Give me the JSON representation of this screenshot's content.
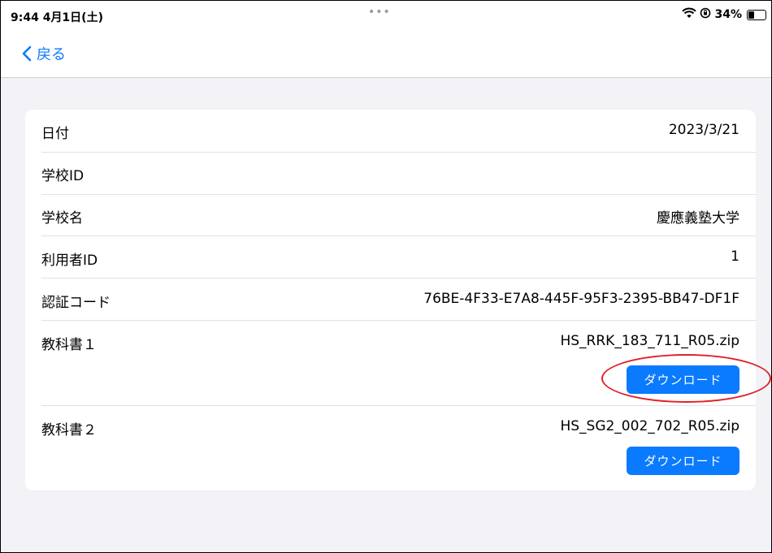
{
  "status_bar": {
    "time": "9:44  4月1日(土)",
    "dots": "•••",
    "battery_percent": "34%",
    "battery_level": 0.34,
    "icons": [
      "wifi-icon",
      "orientation-lock-icon",
      "battery-icon"
    ]
  },
  "nav": {
    "back_label": "戻る",
    "back_icon": "chevron-left-icon",
    "accent_color": "#0a7aff"
  },
  "details": {
    "date_label": "日付",
    "date_value": "2023/3/21",
    "school_id_label": "学校ID",
    "school_id_value": "",
    "school_name_label": "学校名",
    "school_name_value": "慶應義塾大学",
    "user_id_label": "利用者ID",
    "user_id_value": "1",
    "auth_code_label": "認証コード",
    "auth_code_value": "76BE-4F33-E7A8-445F-95F3-2395-BB47-DF1F"
  },
  "textbooks": [
    {
      "label": "教科書１",
      "file": "HS_RRK_183_711_R05.zip",
      "button": "ダウンロード"
    },
    {
      "label": "教科書２",
      "file": "HS_SG2_002_702_R05.zip",
      "button": "ダウンロード"
    }
  ],
  "annotation_color": "#e0202a"
}
